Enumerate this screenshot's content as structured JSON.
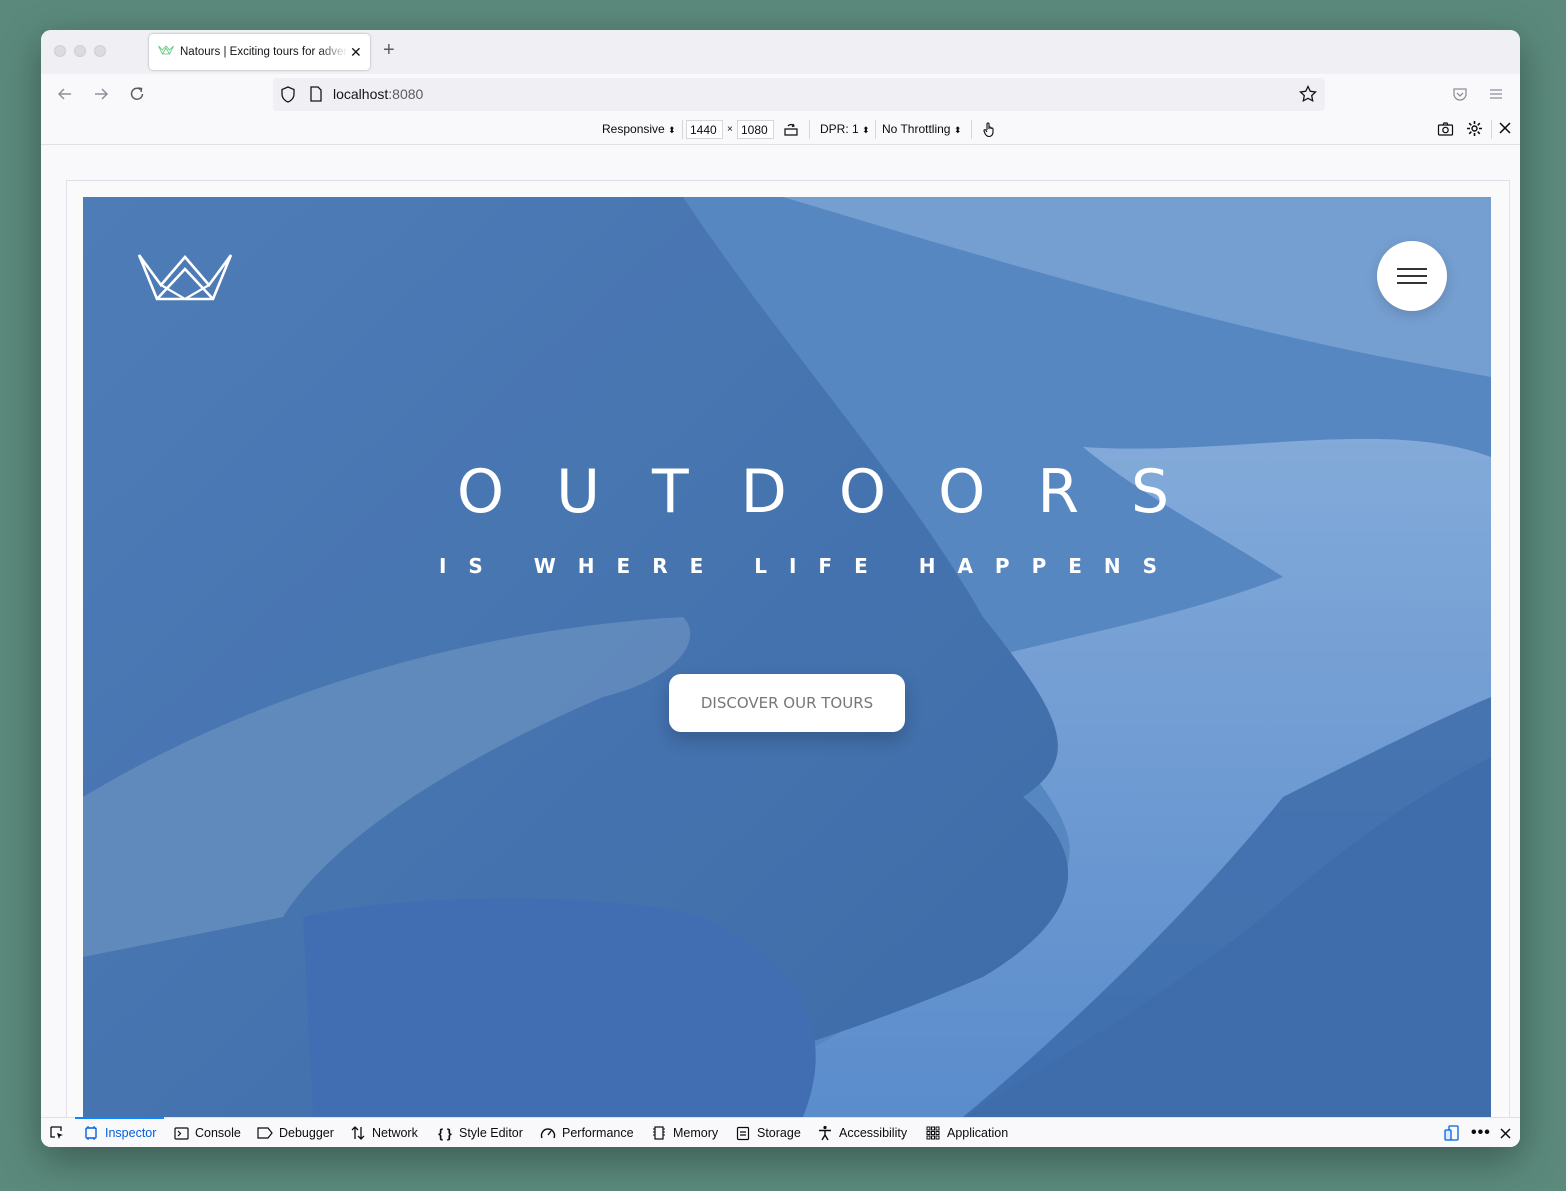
{
  "browser": {
    "tab_title": "Natours | Exciting tours for adventurous people",
    "url_host": "localhost",
    "url_port": ":8080"
  },
  "rdm_toolbar": {
    "device": "Responsive",
    "width": "1440",
    "times": "×",
    "height": "1080",
    "dpr": "DPR: 1",
    "throttling": "No Throttling"
  },
  "hero": {
    "title": "OUTDOORS",
    "subtitle": "IS WHERE LIFE HAPPENS",
    "cta_label": "DISCOVER OUR TOURS",
    "overlay_color": "#4f7fba"
  },
  "devtools": {
    "tabs": [
      {
        "label": "Inspector",
        "icon": "inspector-icon",
        "active": true
      },
      {
        "label": "Console",
        "icon": "console-icon"
      },
      {
        "label": "Debugger",
        "icon": "debugger-icon"
      },
      {
        "label": "Network",
        "icon": "network-icon"
      },
      {
        "label": "Style Editor",
        "icon": "style-editor-icon"
      },
      {
        "label": "Performance",
        "icon": "performance-icon"
      },
      {
        "label": "Memory",
        "icon": "memory-icon"
      },
      {
        "label": "Storage",
        "icon": "storage-icon"
      },
      {
        "label": "Accessibility",
        "icon": "accessibility-icon"
      },
      {
        "label": "Application",
        "icon": "application-icon"
      }
    ]
  },
  "colors": {
    "accent": "#0a84ff",
    "active_tab_text": "#0060df"
  }
}
